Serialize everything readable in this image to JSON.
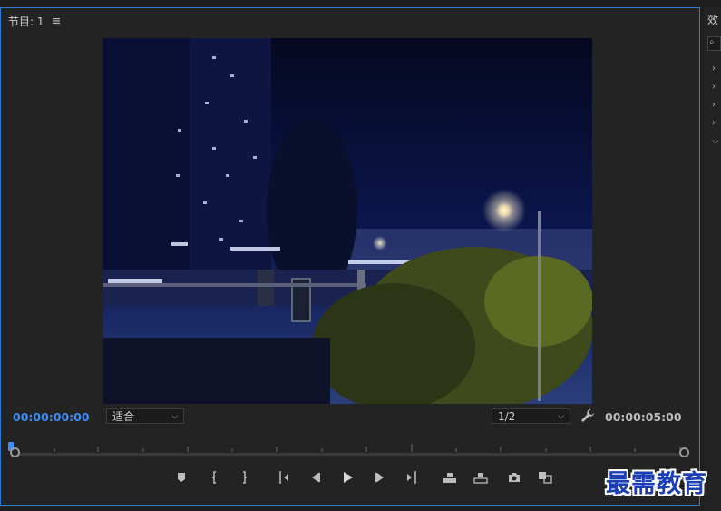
{
  "panel": {
    "title": "节目: 1",
    "menu_icon": "hamburger-menu-icon"
  },
  "video": {
    "description_icon": "video-frame"
  },
  "timecode": {
    "current": "00:00:00:00",
    "total": "00:00:05:00"
  },
  "dropdowns": {
    "zoom": "适合",
    "resolution": "1/2"
  },
  "icons": {
    "wrench": "wrench-icon"
  },
  "controls": [
    {
      "name": "add-marker-button",
      "icon": "marker-icon"
    },
    {
      "name": "mark-in-button",
      "icon": "mark-in-icon"
    },
    {
      "name": "mark-out-button",
      "icon": "mark-out-icon"
    },
    {
      "name": "go-to-in-button",
      "icon": "go-to-in-icon"
    },
    {
      "name": "step-back-button",
      "icon": "step-back-icon"
    },
    {
      "name": "play-button",
      "icon": "play-icon"
    },
    {
      "name": "step-forward-button",
      "icon": "step-forward-icon"
    },
    {
      "name": "go-to-out-button",
      "icon": "go-to-out-icon"
    },
    {
      "name": "lift-button",
      "icon": "lift-icon"
    },
    {
      "name": "extract-button",
      "icon": "extract-icon"
    },
    {
      "name": "export-frame-button",
      "icon": "camera-icon"
    },
    {
      "name": "comparison-view-button",
      "icon": "comparison-view-icon"
    }
  ],
  "right_panel": {
    "tab": "效"
  },
  "watermark": "最需教育",
  "colors": {
    "accent": "#2e7bd6",
    "timecode_current": "#3d8df5",
    "watermark": "#1d3fb5"
  }
}
